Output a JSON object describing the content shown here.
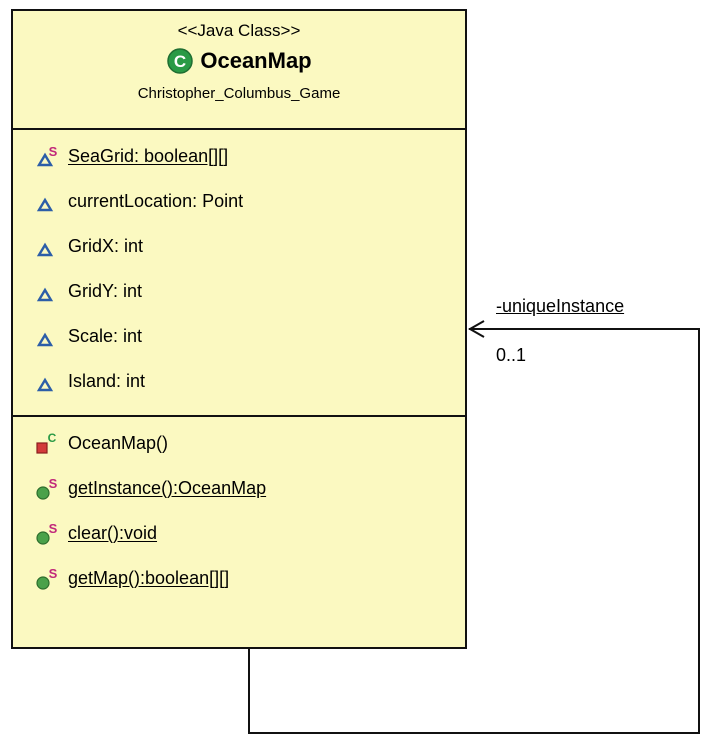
{
  "class": {
    "stereotype": "<<Java Class>>",
    "name": "OceanMap",
    "package": "Christopher_Columbus_Game"
  },
  "attributes": [
    {
      "text": "SeaGrid: boolean[][]",
      "static": true
    },
    {
      "text": "currentLocation: Point",
      "static": false
    },
    {
      "text": "GridX: int",
      "static": false
    },
    {
      "text": "GridY: int",
      "static": false
    },
    {
      "text": "Scale: int",
      "static": false
    },
    {
      "text": "Island: int",
      "static": false
    }
  ],
  "operations": [
    {
      "text": "OceanMap()",
      "static": false,
      "kind": "constructor"
    },
    {
      "text": "getInstance():OceanMap",
      "static": true,
      "kind": "method"
    },
    {
      "text": "clear():void",
      "static": true,
      "kind": "method"
    },
    {
      "text": "getMap():boolean[][]",
      "static": true,
      "kind": "method"
    }
  ],
  "association": {
    "role": "-uniqueInstance",
    "multiplicity": "0..1"
  },
  "icons": {
    "class": "class-icon",
    "attribute": "package-field-icon",
    "constructor": "private-constructor-icon",
    "method": "public-method-icon",
    "static_marker": "S",
    "constructor_marker": "C"
  },
  "colors": {
    "class_fill": "#fbf9c1",
    "class_icon": "#2a9a45",
    "field_icon": "#2c5ea8",
    "constructor_icon": "#d33a3a",
    "method_icon": "#4aa14a",
    "static_marker": "#c1287a"
  }
}
